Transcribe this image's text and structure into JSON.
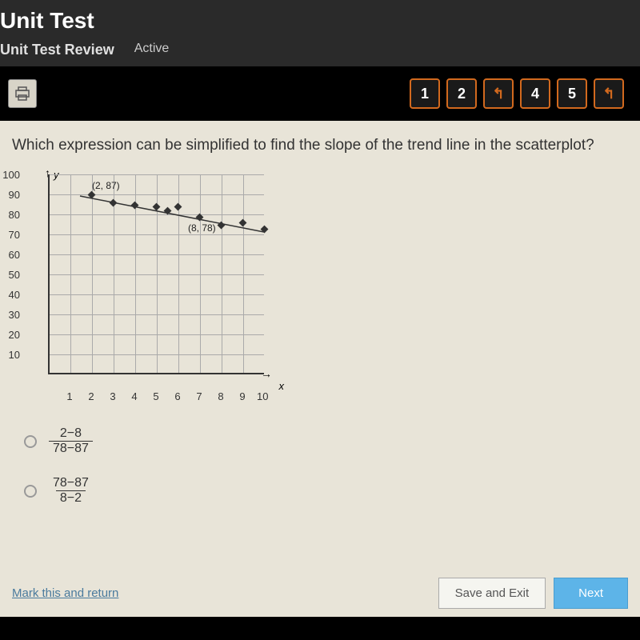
{
  "header": {
    "title": "Unit Test",
    "subtitle": "Unit Test Review",
    "active_label": "Active"
  },
  "nav": {
    "items": [
      "1",
      "2",
      "↰",
      "4",
      "5",
      "↰"
    ]
  },
  "question": "Which expression can be simplified to find the slope of the trend line in the scatterplot?",
  "chart_data": {
    "type": "scatter",
    "xlabel": "x",
    "ylabel": "y",
    "xlim": [
      0,
      10
    ],
    "ylim": [
      0,
      100
    ],
    "x_ticks": [
      1,
      2,
      3,
      4,
      5,
      6,
      7,
      8,
      9,
      10
    ],
    "y_ticks": [
      10,
      20,
      30,
      40,
      50,
      60,
      70,
      80,
      90,
      100
    ],
    "points": [
      {
        "x": 2,
        "y": 88
      },
      {
        "x": 3,
        "y": 84
      },
      {
        "x": 4,
        "y": 83
      },
      {
        "x": 5,
        "y": 82
      },
      {
        "x": 5.5,
        "y": 80
      },
      {
        "x": 6,
        "y": 82
      },
      {
        "x": 7,
        "y": 77
      },
      {
        "x": 8,
        "y": 73
      },
      {
        "x": 9,
        "y": 74
      },
      {
        "x": 10,
        "y": 71
      }
    ],
    "trend_line": {
      "x1": 1.5,
      "y1": 89,
      "x2": 10,
      "y2": 71
    },
    "annotations": [
      {
        "text": "(2, 87)",
        "x": 2.3,
        "y": 92
      },
      {
        "text": "(8, 78)",
        "x": 7.2,
        "y": 71
      }
    ]
  },
  "options": [
    {
      "numerator": "2−8",
      "denominator": "78−87"
    },
    {
      "numerator": "78−87",
      "denominator": "8−2"
    }
  ],
  "footer": {
    "mark_link": "Mark this and return",
    "save_btn": "Save and Exit",
    "next_btn": "Next"
  }
}
